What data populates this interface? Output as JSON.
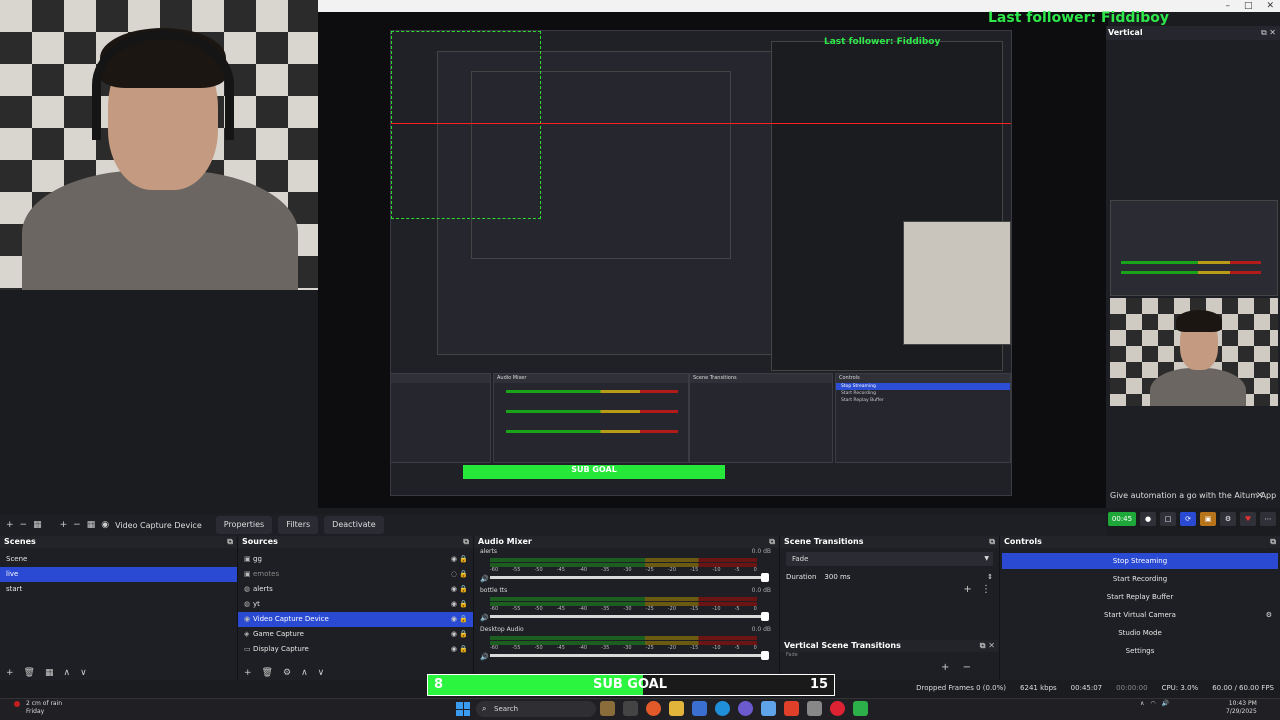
{
  "overlay": {
    "last_follower_large": "Last follower: Fiddiboy",
    "last_follower_small": "Last follower: Fiddiboy"
  },
  "vertical": {
    "title": "Vertical",
    "notice": "Give automation a go with the Aitum App",
    "toolbar_live": "00:45"
  },
  "toolbar": {
    "source_label": "Video Capture Device",
    "properties": "Properties",
    "filters": "Filters",
    "deactivate": "Deactivate"
  },
  "scenes": {
    "title": "Scenes",
    "items": [
      "Scene",
      "live",
      "start"
    ],
    "selected_index": 1
  },
  "sources": {
    "title": "Sources",
    "items": [
      "gg",
      "emotes",
      "alerts",
      "yt",
      "Video Capture Device",
      "Game Capture",
      "Display Capture"
    ],
    "selected_index": 4
  },
  "mixer": {
    "title": "Audio Mixer",
    "scale": [
      "-60",
      "-55",
      "-50",
      "-45",
      "-40",
      "-35",
      "-30",
      "-25",
      "-20",
      "-15",
      "-10",
      "-5",
      "0"
    ],
    "channels": [
      {
        "name": "alerts",
        "db": "0.0 dB"
      },
      {
        "name": "bottle tts",
        "db": "0.0 dB"
      },
      {
        "name": "Desktop Audio",
        "db": "0.0 dB"
      }
    ]
  },
  "transitions": {
    "title": "Scene Transitions",
    "type": "Fade",
    "duration_label": "Duration",
    "duration_value": "300 ms",
    "vertical_title": "Vertical Scene Transitions",
    "vertical_type": "Fade"
  },
  "controls": {
    "title": "Controls",
    "buttons": [
      "Stop Streaming",
      "Start Recording",
      "Start Replay Buffer",
      "Start Virtual Camera",
      "Studio Mode",
      "Settings"
    ]
  },
  "subgoal": {
    "current": "8",
    "label": "SUB GOAL",
    "target": "15",
    "progress": 0.53
  },
  "status": {
    "dropped": "Dropped Frames 0 (0.0%)",
    "bitrate": "6241 kbps",
    "time": "00:45:07",
    "rec": "00:00:00",
    "cpu": "CPU: 3.0%",
    "fps": "60.00 / 60.00 FPS"
  },
  "taskbar": {
    "weather_line1": "2 cm of rain",
    "weather_line2": "Friday",
    "search": "Search",
    "time": "10:43 PM",
    "date": "7/29/2025"
  },
  "colors": {
    "accent": "#2a4ad4",
    "goal_green": "#2cf540",
    "follower_green": "#2ee84a"
  }
}
